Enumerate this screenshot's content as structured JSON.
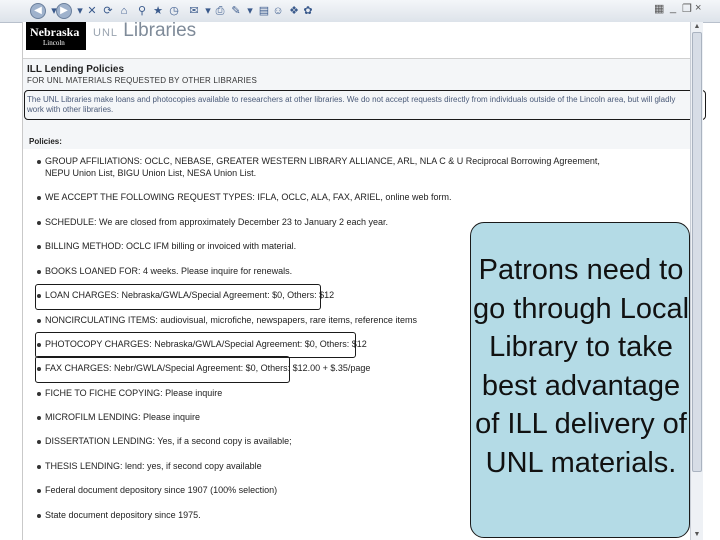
{
  "browser": {
    "toolbar_icons": [
      "back-icon",
      "forward-icon",
      "stop-icon",
      "refresh-icon",
      "home-icon",
      "search-icon",
      "favorites-icon",
      "history-icon",
      "mail-icon",
      "print-icon",
      "edit-icon",
      "discuss-icon",
      "messenger-icon"
    ],
    "window_controls": {
      "minimize": "_",
      "restore": "❐",
      "close": "×"
    }
  },
  "header": {
    "logo_text": "Nebraska",
    "logo_sub": "Lincoln",
    "unl_label": "UNL",
    "libraries_label": "Libraries"
  },
  "page": {
    "title": "ILL Lending Policies",
    "subtitle": "FOR UNL MATERIALS REQUESTED BY OTHER LIBRARIES",
    "intro": "The UNL Libraries make loans and photocopies available to researchers at other libraries. We do not accept requests directly from individuals outside of the Lincoln area, but will gladly work with other libraries.",
    "policies_label": "Policies:",
    "items": [
      {
        "text": "GROUP AFFILIATIONS: OCLC, NEBASE, GREATER WESTERN LIBRARY ALLIANCE, ARL, NLA C & U Reciprocal Borrowing Agreement,"
      },
      {
        "text": "NEPU Union List, BIGU Union List, NESA Union List."
      },
      {
        "text": "WE ACCEPT THE FOLLOWING REQUEST TYPES: IFLA, OCLC, ALA, FAX, ARIEL, online web form."
      },
      {
        "text": "SCHEDULE: We are closed from approximately December 23 to January 2 each year."
      },
      {
        "text": "BILLING METHOD: OCLC IFM billing or invoiced with material."
      },
      {
        "text": "BOOKS LOANED FOR: 4 weeks. Please inquire for renewals."
      },
      {
        "text": "LOAN CHARGES: Nebraska/GWLA/Special Agreement: $0, Others: $12"
      },
      {
        "text": "NONCIRCULATING ITEMS: audiovisual, microfiche, newspapers, rare items, reference items"
      },
      {
        "text": "PHOTOCOPY CHARGES: Nebraska/GWLA/Special Agreement: $0, Others: $12"
      },
      {
        "text": "FAX CHARGES: Nebr/GWLA/Special Agreement: $0, Others: $12.00 + $.35/page"
      },
      {
        "text": "FICHE TO FICHE COPYING: Please inquire"
      },
      {
        "text": "MICROFILM LENDING: Please inquire"
      },
      {
        "text": "DISSERTATION LENDING: Yes, if a second copy is available;"
      },
      {
        "text": "THESIS LENDING: lend: yes, if second copy available"
      },
      {
        "text": "Federal document depository since 1907 (100% selection)"
      },
      {
        "text": "State document depository since 1975."
      }
    ]
  },
  "callout": {
    "text": "Patrons need to go through Local Library to take best advantage of ILL delivery of UNL materials."
  }
}
